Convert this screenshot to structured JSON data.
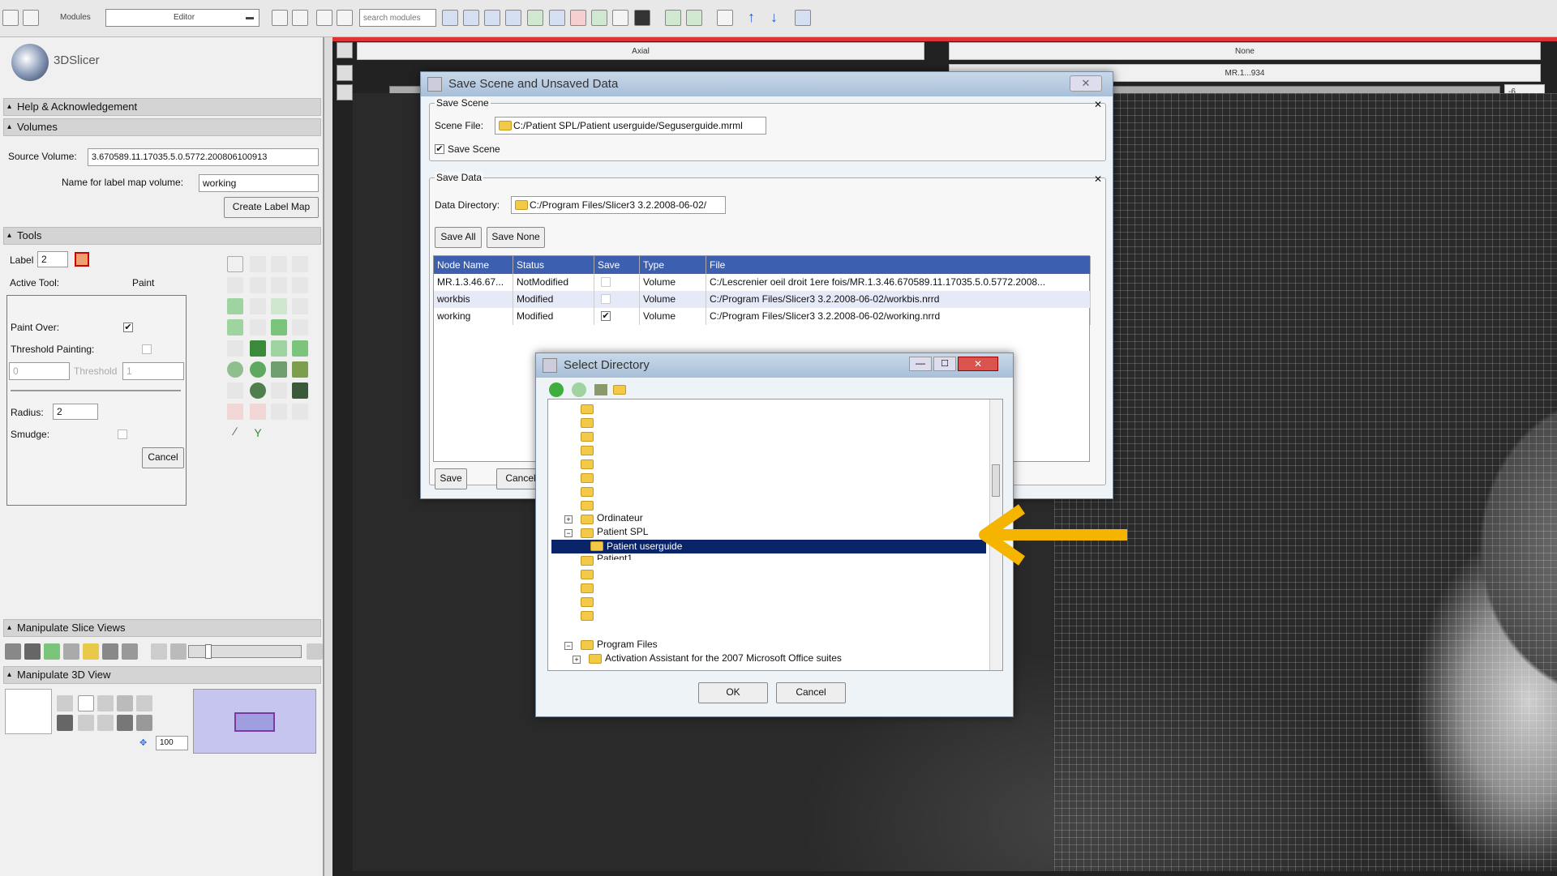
{
  "toolbar": {
    "modules_label": "Modules",
    "module_value": "Editor",
    "search_placeholder": "search modules"
  },
  "app": {
    "name": "3DSlicer"
  },
  "left": {
    "help_title": "Help & Acknowledgement",
    "volumes_title": "Volumes",
    "source_volume_label": "Source Volume:",
    "source_volume_value": "3.670589.11.17035.5.0.5772.200806100913",
    "label_map_name_label": "Name for label map volume:",
    "label_map_name_value": "working",
    "create_label_map": "Create Label Map",
    "tools_title": "Tools",
    "label_label": "Label",
    "label_value": "2",
    "active_tool_label": "Active Tool:",
    "active_tool_value": "Paint",
    "paint_over_label": "Paint Over:",
    "threshold_painting_label": "Threshold Painting:",
    "threshold_min": "0",
    "threshold_label": "Threshold",
    "threshold_max": "1",
    "radius_label": "Radius:",
    "radius_value": "2",
    "smudge_label": "Smudge:",
    "cancel": "Cancel",
    "manipulate_slice_title": "Manipulate Slice Views",
    "manipulate_3d_title": "Manipulate 3D View",
    "zoom_value": "100"
  },
  "viewer": {
    "axial": "Axial",
    "none": "None",
    "mr": "MR.1...934",
    "offset": "-6"
  },
  "save_dialog": {
    "title": "Save Scene and Unsaved Data",
    "save_scene_group": "Save Scene",
    "scene_file_label": "Scene File:",
    "scene_file_value": "C:/Patient SPL/Patient userguide/Seguserguide.mrml",
    "save_scene_check": "Save Scene",
    "save_data_group": "Save Data",
    "data_dir_label": "Data Directory:",
    "data_dir_value": "C:/Program Files/Slicer3 3.2.2008-06-02/",
    "save_all": "Save All",
    "save_none": "Save None",
    "columns": [
      "Node Name",
      "Status",
      "Save",
      "Type",
      "File"
    ],
    "rows": [
      {
        "node": "MR.1.3.46.67...",
        "status": "NotModified",
        "save": "",
        "type": "Volume",
        "file": "C:/Lescrenier oeil droit 1ere fois/MR.1.3.46.670589.11.17035.5.0.5772.2008..."
      },
      {
        "node": "workbis",
        "status": "Modified",
        "save": "",
        "type": "Volume",
        "file": "C:/Program Files/Slicer3 3.2.2008-06-02/workbis.nrrd"
      },
      {
        "node": "working",
        "status": "Modified",
        "save": "✔",
        "type": "Volume",
        "file": "C:/Program Files/Slicer3 3.2.2008-06-02/working.nrrd"
      }
    ],
    "save": "Save",
    "cancel": "Cancel"
  },
  "select_dialog": {
    "title": "Select Directory",
    "tree": {
      "ordinateur": "Ordinateur",
      "patient_spl": "Patient SPL",
      "patient_userguide": "Patient userguide",
      "patient1": "Patient1",
      "program_files": "Program Files",
      "activation": "Activation Assistant for the 2007 Microsoft Office suites"
    },
    "ok": "OK",
    "cancel": "Cancel"
  },
  "colors": {
    "arrow": "#f5b400",
    "selection": "#0a246a",
    "header": "#3c5fb0"
  }
}
